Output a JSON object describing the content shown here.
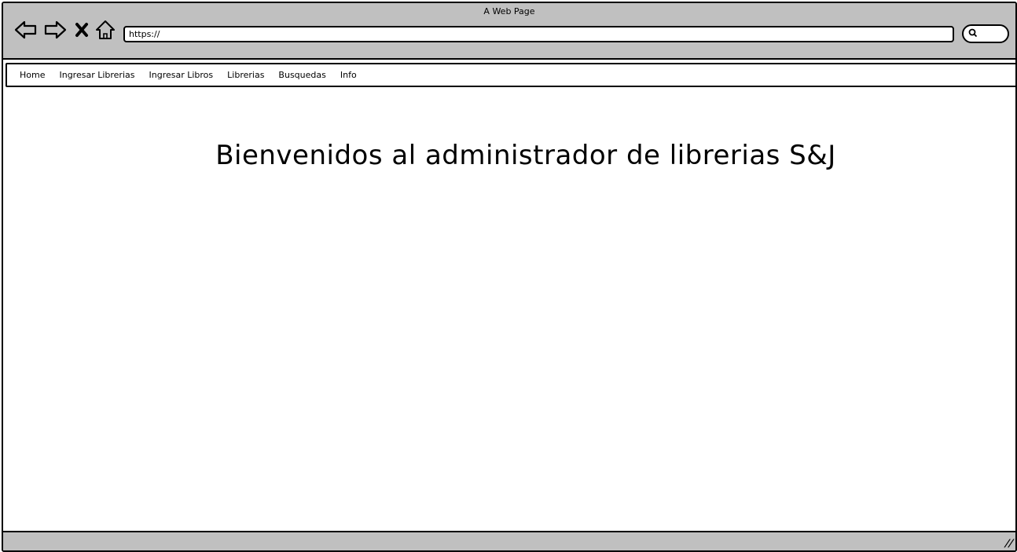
{
  "window": {
    "title": "A Web Page"
  },
  "toolbar": {
    "back_icon": "back-arrow-icon",
    "forward_icon": "forward-arrow-icon",
    "stop_icon": "close-icon",
    "home_icon": "home-icon",
    "search_icon": "search-icon"
  },
  "address_bar": {
    "value": "https://"
  },
  "navbar": {
    "items": [
      {
        "label": "Home"
      },
      {
        "label": "Ingresar Librerias"
      },
      {
        "label": "Ingresar Libros"
      },
      {
        "label": "Librerias"
      },
      {
        "label": "Busquedas"
      },
      {
        "label": "Info"
      }
    ]
  },
  "main": {
    "heading": "Bienvenidos al administrador de librerias S&J"
  },
  "statusbar": {
    "grip_icon": "resize-grip-icon"
  },
  "colors": {
    "chrome": "#c0c0c0",
    "border": "#000000",
    "content_bg": "#ffffff"
  }
}
